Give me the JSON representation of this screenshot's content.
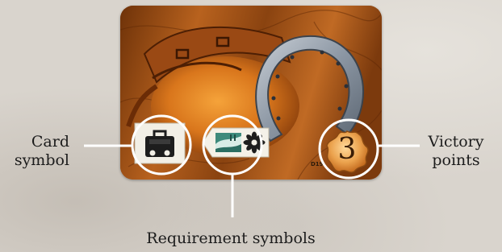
{
  "labels": {
    "card_symbol_line1": "Card",
    "card_symbol_line2": "symbol",
    "victory_points_line1": "Victory",
    "victory_points_line2": "points",
    "requirement_symbols": "Requirement symbols"
  },
  "card": {
    "victory_points": "3",
    "card_code": "D19",
    "card_symbol_icon": "briefcase-icon",
    "requirement_icons": [
      "landscape-icon",
      "flower-icon"
    ]
  },
  "colors": {
    "background": "#d9d4cd",
    "callout_line": "#ffffff",
    "card_wood": "#a9561a",
    "badge_orange": "#e8a04a"
  }
}
